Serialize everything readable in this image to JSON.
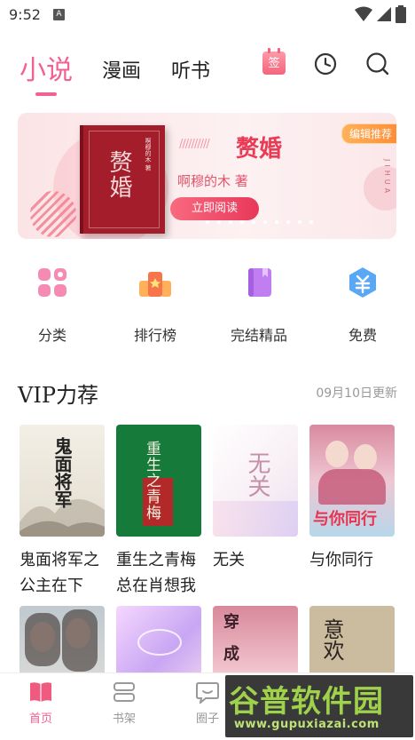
{
  "status_bar": {
    "time": "9:52",
    "notification_badge": "A"
  },
  "tabs": {
    "active": "小说",
    "comic": "漫画",
    "audio": "听书"
  },
  "sign_icon_label": "签",
  "banner": {
    "title": "赘婚",
    "slashes": "//////////",
    "author": "啊穆的木  著",
    "read_button": "立即阅读",
    "tag": "编辑推荐",
    "side_text": "JIHUA",
    "book_cover_title": "赘婚",
    "book_cover_author": "啊穆的木 著",
    "dots": 10
  },
  "categories": [
    {
      "label": "分类",
      "icon": "grid-icon"
    },
    {
      "label": "排行榜",
      "icon": "ranking-icon"
    },
    {
      "label": "完结精品",
      "icon": "book-icon"
    },
    {
      "label": "免费",
      "icon": "free-icon"
    }
  ],
  "vip": {
    "title": "VIP力荐",
    "date": "09月10日更新",
    "books": [
      {
        "line1": "鬼面将军之",
        "line2": "公主在下",
        "cover_text": "鬼面将军"
      },
      {
        "line1": "重生之青梅",
        "line2": "总在肖想我",
        "cover_text": "重生之青梅"
      },
      {
        "line1": "无关",
        "line2": "",
        "cover_text": "无关"
      },
      {
        "line1": "与你同行",
        "line2": "",
        "cover_text": "与你同行"
      }
    ],
    "row2_cover_texts": [
      "",
      "",
      "穿成",
      "意欢"
    ]
  },
  "bottom_nav": [
    {
      "label": "首页",
      "icon": "home-book-icon",
      "active": true
    },
    {
      "label": "书架",
      "icon": "bookshelf-icon",
      "active": false
    },
    {
      "label": "圈子",
      "icon": "chat-icon",
      "active": false
    }
  ],
  "watermark": {
    "logo": "谷普软件园",
    "url": "www.gupuxiazai.com"
  },
  "colors": {
    "accent": "#f06292",
    "banner_red": "#ea3a55"
  }
}
